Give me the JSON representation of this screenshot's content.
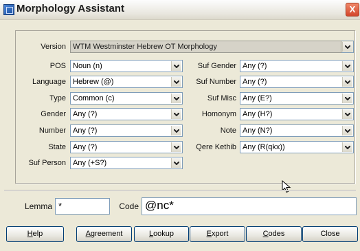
{
  "window": {
    "title": "Morphology Assistant",
    "close_label": "X"
  },
  "version": {
    "label": "Version",
    "value": "WTM Westminster Hebrew OT Morphology"
  },
  "left_fields": [
    {
      "label": "POS",
      "value": "Noun (n)"
    },
    {
      "label": "Language",
      "value": "Hebrew (@)"
    },
    {
      "label": "Type",
      "value": "Common (c)"
    },
    {
      "label": "Gender",
      "value": "Any (?)"
    },
    {
      "label": "Number",
      "value": "Any (?)"
    },
    {
      "label": "State",
      "value": "Any (?)"
    },
    {
      "label": "Suf Person",
      "value": "Any (+S?)"
    }
  ],
  "right_fields": [
    {
      "label": "Suf Gender",
      "value": "Any (?)"
    },
    {
      "label": "Suf Number",
      "value": "Any (?)"
    },
    {
      "label": "Suf Misc",
      "value": "Any (E?)"
    },
    {
      "label": "Homonym",
      "value": "Any (H?)"
    },
    {
      "label": "Note",
      "value": "Any (N?)"
    },
    {
      "label": "Qere Kethib",
      "value": "Any (R(qkx))"
    }
  ],
  "lemma": {
    "label": "Lemma",
    "value": "*"
  },
  "code": {
    "label": "Code",
    "value": "@nc*"
  },
  "buttons": {
    "help": {
      "mnemonic": "H",
      "rest": "elp"
    },
    "agreement": {
      "mnemonic": "A",
      "rest": "greement"
    },
    "lookup": {
      "mnemonic": "L",
      "rest": "ookup"
    },
    "export": {
      "mnemonic": "E",
      "rest": "xport"
    },
    "codes": {
      "mnemonic": "C",
      "rest": "odes"
    },
    "close": {
      "mnemonic": "",
      "rest": "Close"
    }
  },
  "icons": {
    "app": "app-icon",
    "dropdown": "chevron-down-icon",
    "pointer": "mouse-pointer-icon"
  }
}
